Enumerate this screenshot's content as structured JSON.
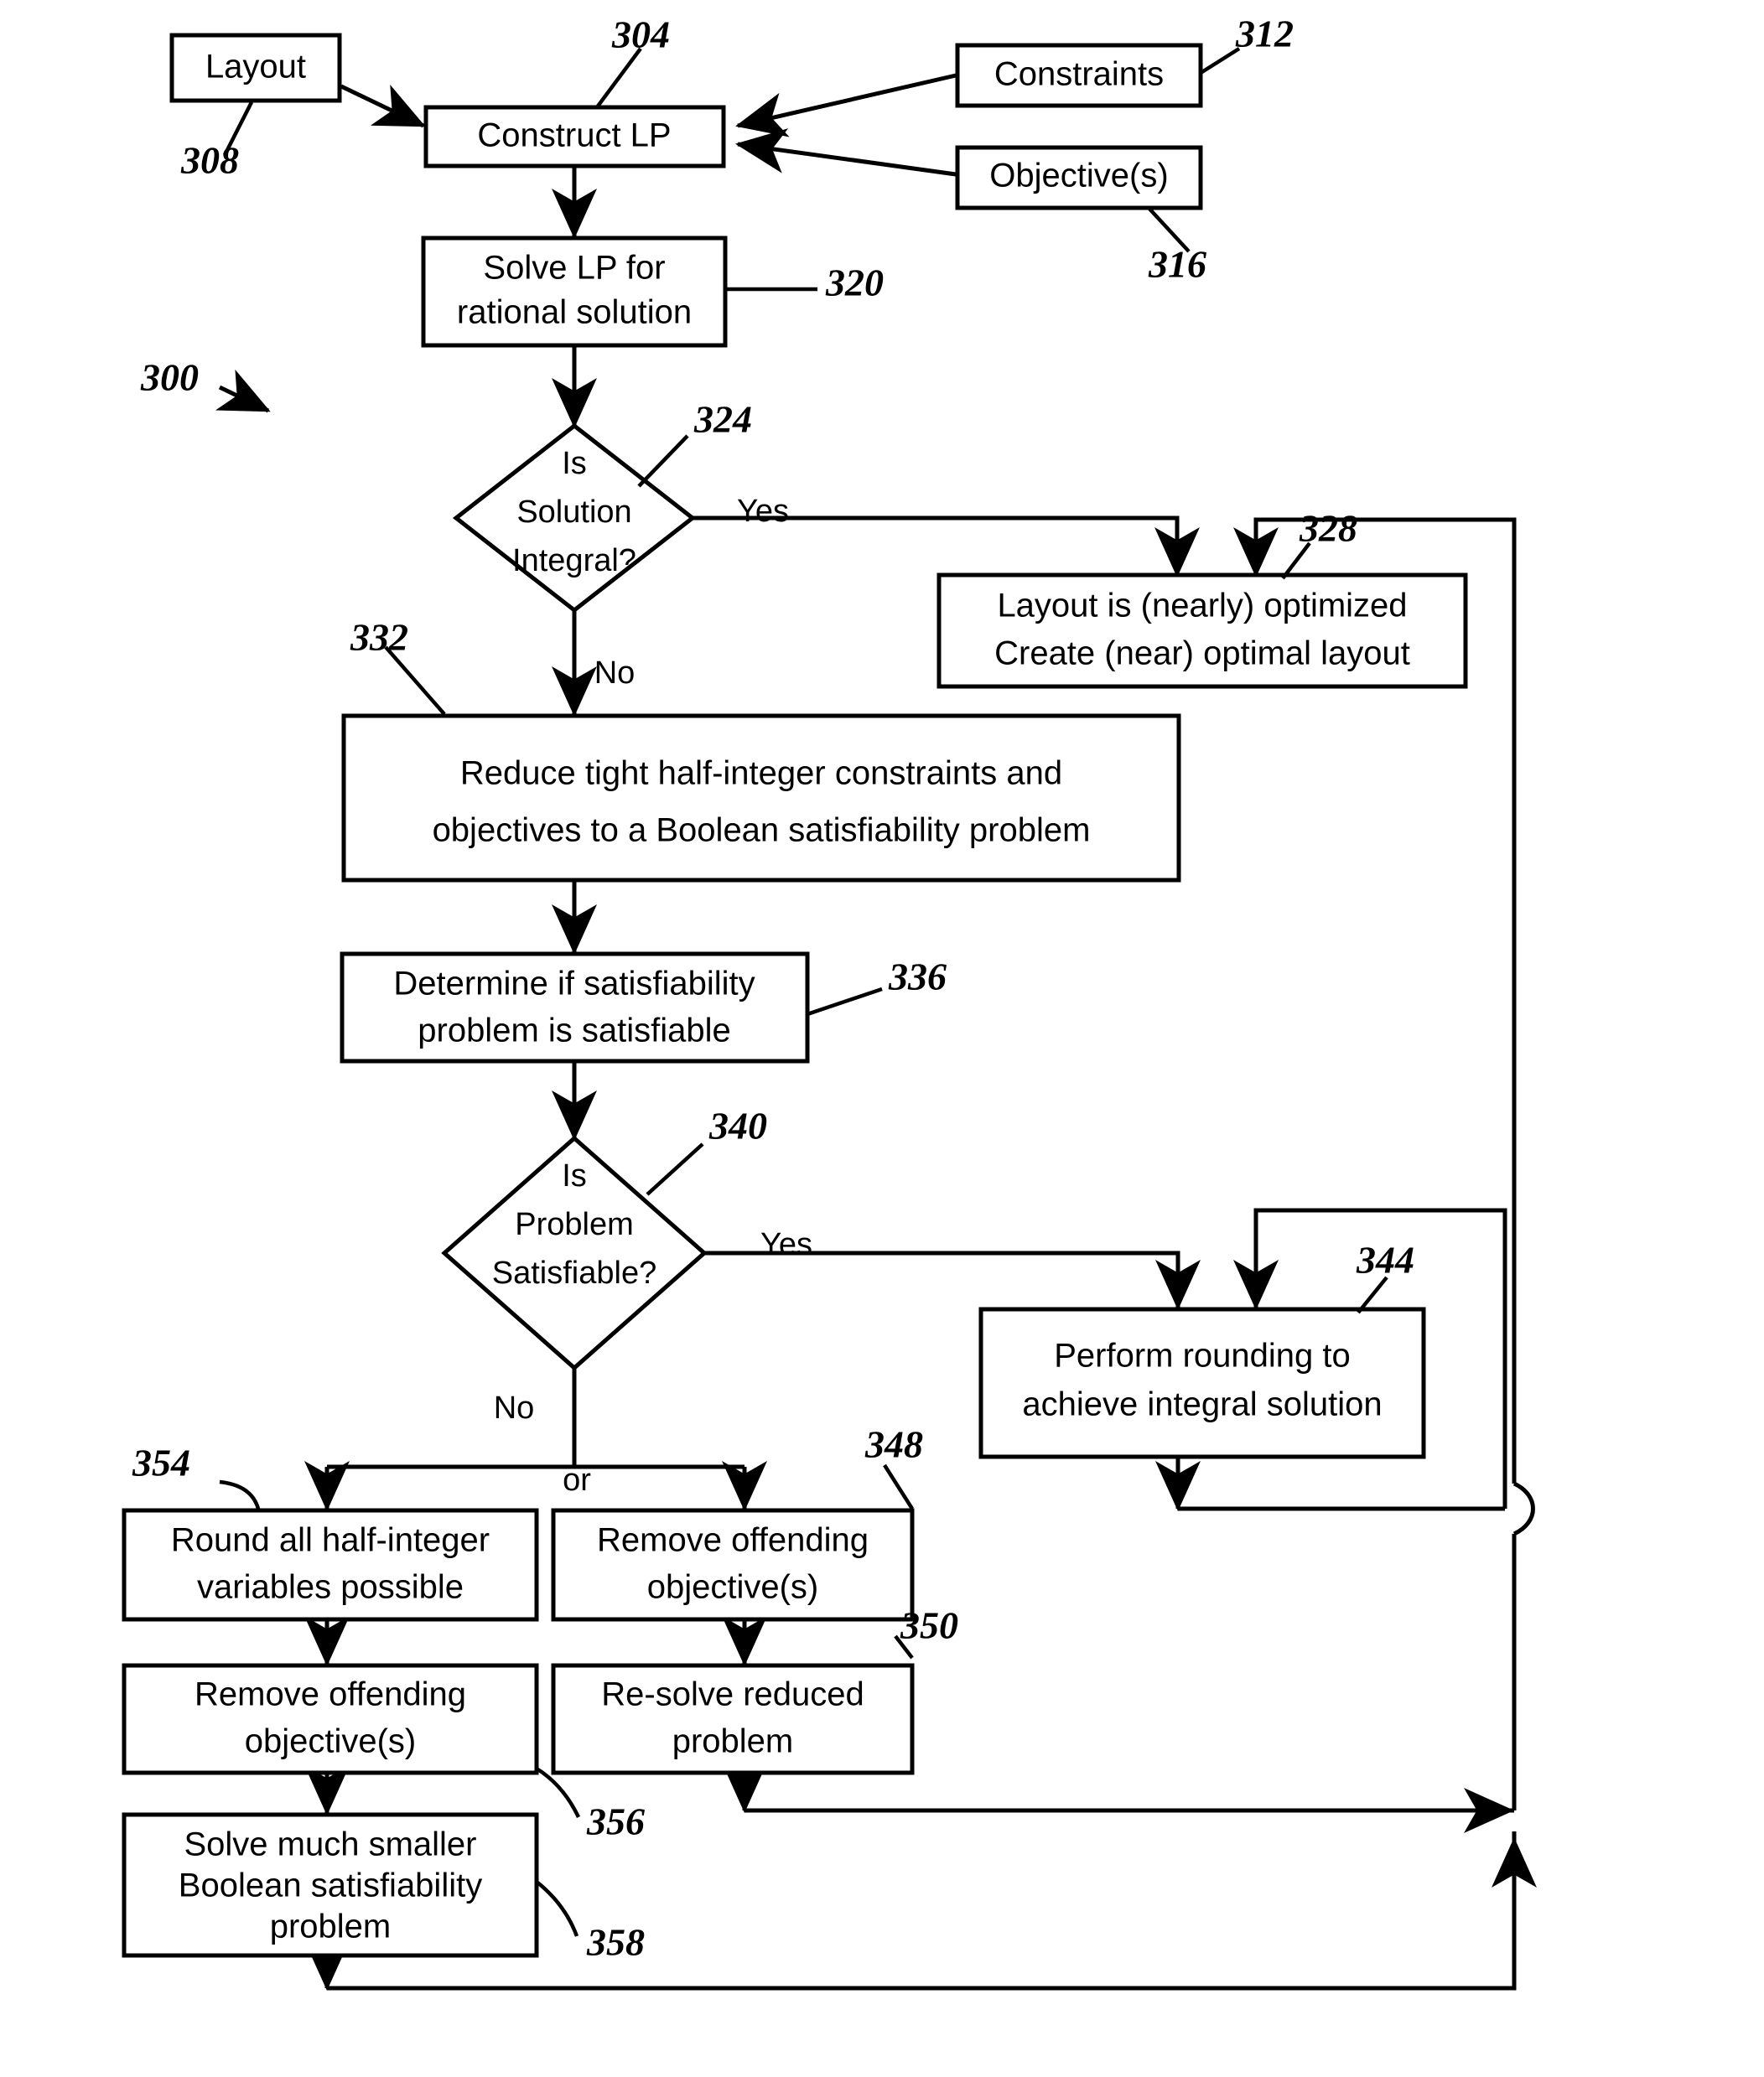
{
  "figure": {
    "number": "300",
    "type": "flowchart",
    "title": ""
  },
  "nodes": [
    {
      "id": "layout",
      "ref": "308",
      "shape": "rect",
      "lines": [
        "Layout"
      ]
    },
    {
      "id": "construct",
      "ref": "304",
      "shape": "rect",
      "lines": [
        "Construct LP"
      ]
    },
    {
      "id": "constraints",
      "ref": "312",
      "shape": "rect",
      "lines": [
        "Constraints"
      ]
    },
    {
      "id": "objectives",
      "ref": "316",
      "shape": "rect",
      "lines": [
        "Objective(s)"
      ]
    },
    {
      "id": "solvelp",
      "ref": "320",
      "shape": "rect",
      "lines": [
        "Solve LP for",
        "rational solution"
      ]
    },
    {
      "id": "isintegral",
      "ref": "324",
      "shape": "diamond",
      "lines": [
        "Is",
        "Solution",
        "Integral?"
      ]
    },
    {
      "id": "optimized",
      "ref": "328",
      "shape": "rect",
      "lines": [
        "Layout is (nearly) optimized",
        "Create (near) optimal layout"
      ]
    },
    {
      "id": "reduce",
      "ref": "332",
      "shape": "rect",
      "lines": [
        "Reduce tight half-integer constraints and",
        "objectives to a Boolean satisfiability problem"
      ]
    },
    {
      "id": "determine",
      "ref": "336",
      "shape": "rect",
      "lines": [
        "Determine if satisfiability",
        "problem is satisfiable"
      ]
    },
    {
      "id": "issat",
      "ref": "340",
      "shape": "diamond",
      "lines": [
        "Is",
        "Problem",
        "Satisfiable?"
      ]
    },
    {
      "id": "rounding",
      "ref": "344",
      "shape": "rect",
      "lines": [
        "Perform rounding to",
        "achieve integral solution"
      ]
    },
    {
      "id": "roundall",
      "ref": "354",
      "shape": "rect",
      "lines": [
        "Round all half-integer",
        "variables possible"
      ]
    },
    {
      "id": "removeobj1",
      "ref": "348",
      "shape": "rect",
      "lines": [
        "Remove offending",
        "objective(s)"
      ]
    },
    {
      "id": "removeobj2",
      "ref": "356",
      "shape": "rect",
      "lines": [
        "Remove offending",
        "objective(s)"
      ]
    },
    {
      "id": "resolve",
      "ref": "350",
      "shape": "rect",
      "lines": [
        "Re-solve reduced",
        "problem"
      ]
    },
    {
      "id": "solvesmall",
      "ref": "358",
      "shape": "rect",
      "lines": [
        "Solve much smaller",
        "Boolean satisfiability",
        "problem"
      ]
    }
  ],
  "edge_labels": {
    "integral_yes": "Yes",
    "integral_no": "No",
    "sat_yes": "Yes",
    "sat_no": "No",
    "or": "or"
  },
  "reference_numerals": [
    "300",
    "304",
    "308",
    "312",
    "316",
    "320",
    "324",
    "328",
    "332",
    "336",
    "340",
    "344",
    "348",
    "350",
    "354",
    "356",
    "358"
  ],
  "colors": {
    "stroke": "#000000",
    "fill": "#ffffff",
    "text": "#000000"
  }
}
